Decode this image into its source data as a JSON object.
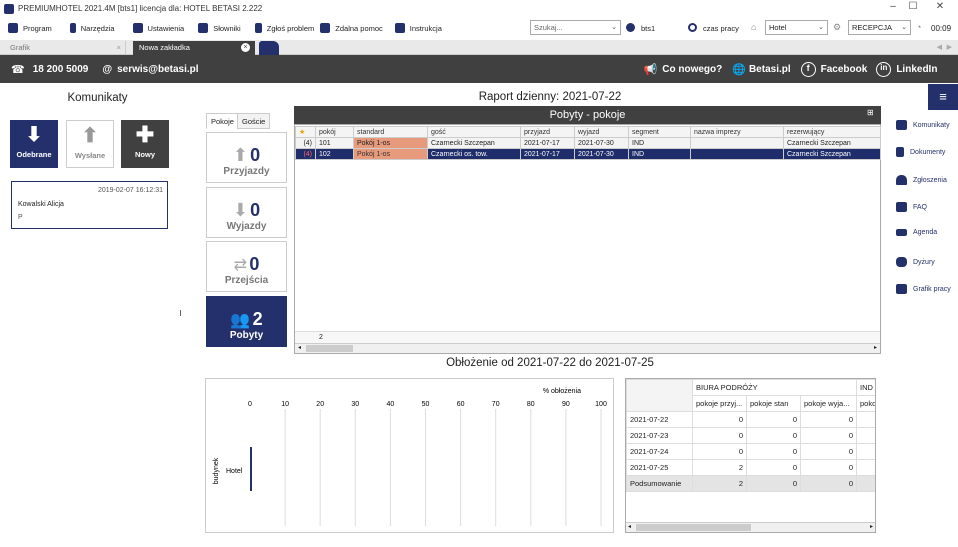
{
  "window": {
    "title": "PREMIUMHOTEL 2021.4M [bts1] licencja dla: HOTEL BETASI 2.222"
  },
  "menu": {
    "program": "Program",
    "narzedzia": "Narzędzia",
    "ustawienia": "Ustawienia",
    "slowniki": "Słowniki",
    "zglos": "Zgłoś problem",
    "pomoc": "Zdalna pomoc",
    "instrukcja": "Instrukcja"
  },
  "toolbar": {
    "search_placeholder": "Szukaj...",
    "user": "bts1",
    "czas": "czas pracy",
    "hotel": "Hotel",
    "recepcja": "RECEPCJA",
    "clock": "00:09"
  },
  "tabs": {
    "grafik": "Grafik",
    "nowa": "Nowa zakładka"
  },
  "banner": {
    "phone": "18 200 5009",
    "email": "serwis@betasi.pl",
    "news": "Co nowego?",
    "site": "Betasi.pl",
    "fb": "Facebook",
    "li": "LinkedIn"
  },
  "komunikaty": {
    "title": "Komunikaty",
    "odebrane": "Odebrane",
    "wyslane": "Wysłane",
    "nowy": "Nowy",
    "message": {
      "date": "2019-02-07 16:12:31",
      "from": "Kowalski Alicja",
      "body": "P"
    }
  },
  "report": {
    "title": "Raport dzienny: 2021-07-22",
    "tab_pokoje": "Pokoje",
    "tab_goscie": "Goście",
    "cards": [
      {
        "n": "0",
        "l": "Przyjazdy"
      },
      {
        "n": "0",
        "l": "Wyjazdy"
      },
      {
        "n": "0",
        "l": "Przejścia"
      },
      {
        "n": "2",
        "l": "Pobyty"
      }
    ],
    "grid_title": "Pobyty - pokoje",
    "columns": [
      "pokój",
      "standard",
      "gość",
      "przyjazd",
      "wyjazd",
      "segment",
      "nazwa imprezy",
      "rezerwujący"
    ],
    "rows": [
      {
        "flag": "(4)",
        "room": "101",
        "std": "Pokój 1-os",
        "guest": "Czarnecki Szczepan",
        "in": "2021-07-17",
        "out": "2021-07-30",
        "seg": "IND",
        "event": "",
        "res": "Czarnecki Szczepan"
      },
      {
        "flag": "(4)",
        "room": "102",
        "std": "Pokój 1-os",
        "guest": "Czarnecki os. tow.",
        "in": "2021-07-17",
        "out": "2021-07-30",
        "seg": "IND",
        "event": "",
        "res": "Czarnecki Szczepan"
      }
    ],
    "count": "2"
  },
  "occupancy": {
    "title": "Obłożenie od 2021-07-22 do 2021-07-25",
    "chart_data": {
      "type": "bar",
      "title": "",
      "xlabel": "% obłożenia",
      "ylabel": "budynek",
      "categories": [
        "Hotel"
      ],
      "values": [
        0
      ],
      "xlim": [
        0,
        100
      ],
      "ticks": [
        "0",
        "10",
        "20",
        "30",
        "40",
        "50",
        "60",
        "70",
        "80",
        "90",
        "100"
      ]
    },
    "table": {
      "group": "BIURA PODRÓŻY",
      "group2": "IND",
      "cols": [
        "pokoje przyj...",
        "pokoje stan",
        "pokoje wyja...",
        "poko"
      ],
      "rows": [
        {
          "d": "2021-07-22",
          "v": [
            "0",
            "0",
            "0"
          ]
        },
        {
          "d": "2021-07-23",
          "v": [
            "0",
            "0",
            "0"
          ]
        },
        {
          "d": "2021-07-24",
          "v": [
            "0",
            "0",
            "0"
          ]
        },
        {
          "d": "2021-07-25",
          "v": [
            "2",
            "0",
            "0"
          ]
        },
        {
          "d": "Podsumowanie",
          "v": [
            "2",
            "0",
            "0"
          ]
        }
      ]
    }
  },
  "sidebar": [
    "Komunikaty",
    "Dokumenty",
    "Zgłoszenia",
    "FAQ",
    "Agenda",
    "Dyżury",
    "Grafik pracy"
  ]
}
